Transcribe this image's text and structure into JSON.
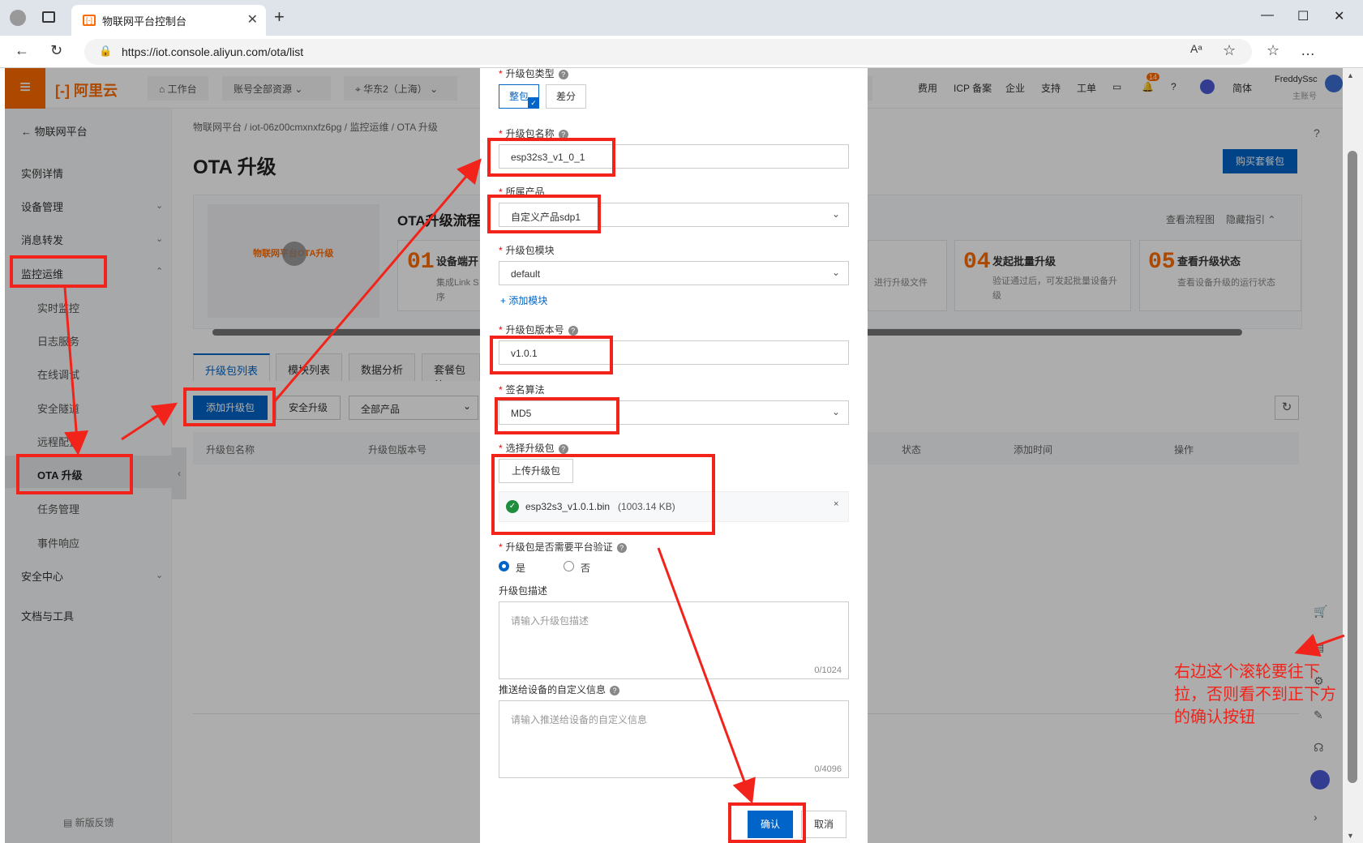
{
  "browser": {
    "tab_title": "物联网平台控制台",
    "url": "https://iot.console.aliyun.com/ota/list"
  },
  "header": {
    "logo": "阿里云",
    "workbench": "工作台",
    "resources": "账号全部资源",
    "region": "华东2（上海）",
    "links": [
      "费用",
      "ICP 备案",
      "企业",
      "支持",
      "工单"
    ],
    "notif_count": "14",
    "lang": "简体",
    "user_name": "FreddySsc",
    "user_role": "主账号"
  },
  "sidebar": {
    "back": "物联网平台",
    "items": [
      "实例详情",
      "设备管理",
      "消息转发",
      "监控运维"
    ],
    "sub_items": [
      "实时监控",
      "日志服务",
      "在线调试",
      "安全隧道",
      "远程配置",
      "OTA 升级",
      "任务管理",
      "事件响应"
    ],
    "bottom_items": [
      "安全中心",
      "文档与工具"
    ],
    "feedback": "新版反馈"
  },
  "main": {
    "breadcrumb": [
      "物联网平台",
      "iot-06z00cmxnxfz6pg",
      "监控运维",
      "OTA 升级"
    ],
    "title": "OTA 升级",
    "buy_button": "购买套餐包",
    "flow_title": "OTA升级流程",
    "flow_links": [
      "查看流程图",
      "隐藏指引"
    ],
    "video_label": "物联网平台OTA升级",
    "steps": [
      {
        "num": "01",
        "title": "设备端开",
        "desc": "集成Link S序"
      },
      {
        "num": "04",
        "title": "发起批量升级",
        "desc": "验证通过后，可发起批量设备升级"
      },
      {
        "num": "05",
        "title": "查看升级状态",
        "desc": "查看设备升级的运行状态"
      }
    ],
    "step_partial": "进行升级文件",
    "tabs": [
      "升级包列表",
      "模块列表",
      "数据分析",
      "套餐包统"
    ],
    "add_button": "添加升级包",
    "secure_button": "安全升级",
    "product_filter": "全部产品",
    "columns": [
      "升级包名称",
      "升级包版本号",
      "状态",
      "添加时间",
      "操作"
    ]
  },
  "form": {
    "type_label": "升级包类型",
    "type_options": [
      "整包",
      "差分"
    ],
    "name_label": "升级包名称",
    "name_value": "esp32s3_v1_0_1",
    "product_label": "所属产品",
    "product_value": "自定义产品sdp1",
    "module_label": "升级包模块",
    "module_value": "default",
    "add_module": "+ 添加模块",
    "version_label": "升级包版本号",
    "version_value": "v1.0.1",
    "sign_label": "签名算法",
    "sign_value": "MD5",
    "file_label": "选择升级包",
    "upload_button": "上传升级包",
    "file_name": "esp32s3_v1.0.1.bin",
    "file_size": "(1003.14 KB)",
    "verify_label": "升级包是否需要平台验证",
    "verify_yes": "是",
    "verify_no": "否",
    "desc_label": "升级包描述",
    "desc_placeholder": "请输入升级包描述",
    "desc_count": "0/1024",
    "custom_label": "推送给设备的自定义信息",
    "custom_placeholder": "请输入推送给设备的自定义信息",
    "custom_count": "0/4096",
    "confirm": "确认",
    "cancel": "取消"
  },
  "annotation": "右边这个滚轮要往下拉，否则看不到正下方的确认按钮",
  "colors": {
    "accent": "#ff6a00",
    "primary": "#0064c8",
    "annot": "#f2231a"
  }
}
